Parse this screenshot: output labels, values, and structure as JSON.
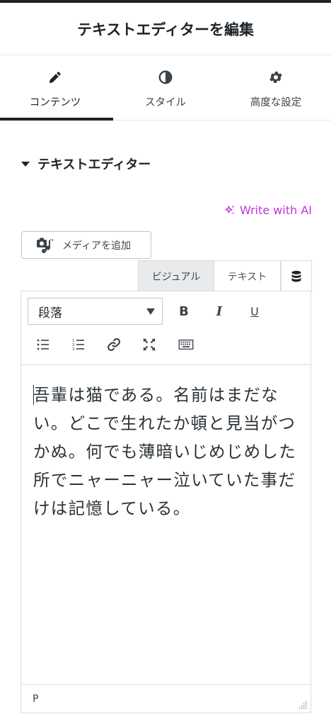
{
  "header": {
    "title": "テキストエディターを編集"
  },
  "tabs": [
    {
      "label": "コンテンツ",
      "icon": "pencil-icon",
      "active": true
    },
    {
      "label": "スタイル",
      "icon": "contrast-icon",
      "active": false
    },
    {
      "label": "高度な設定",
      "icon": "gear-icon",
      "active": false
    }
  ],
  "section": {
    "title": "テキストエディター",
    "icon": "caret-down-icon"
  },
  "ai": {
    "label": "Write with AI",
    "icon": "sparkle-icon",
    "color": "#c036d9"
  },
  "media": {
    "label": "メディアを追加",
    "icon": "add-media-icon"
  },
  "editor_modes": {
    "visual_label": "ビジュアル",
    "text_label": "テキスト",
    "db_icon": "database-icon"
  },
  "toolbar": {
    "format_label": "段落",
    "bold_label": "B",
    "italic_label": "I",
    "underline_label": "U",
    "icons": [
      "bullet-list-icon",
      "numbered-list-icon",
      "link-icon",
      "fullscreen-icon",
      "keyboard-icon"
    ]
  },
  "content": {
    "text": "吾輩は猫である。名前はまだない。どこで生れたか頓と見当がつかぬ。何でも薄暗いじめじめした所でニャーニャー泣いていた事だけは記憶している。"
  },
  "statusbar": {
    "path": "P"
  }
}
